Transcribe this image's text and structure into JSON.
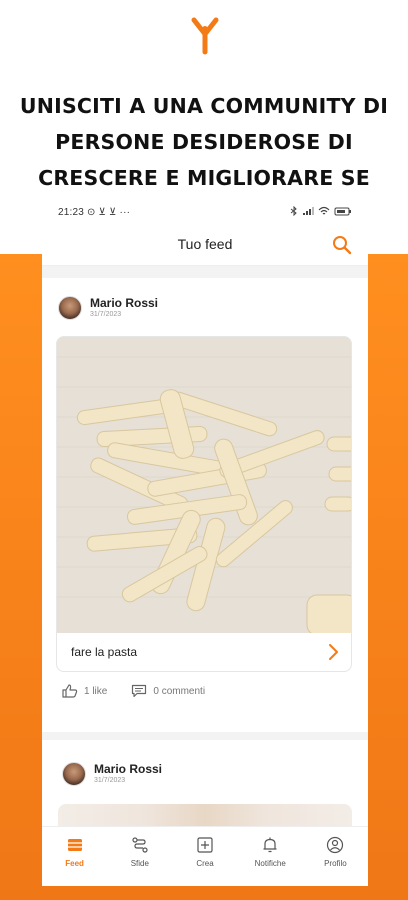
{
  "headline": {
    "line1": "UNISCITI A UNA COMMUNITY DI",
    "line2": "PERSONE DESIDEROSE DI",
    "line3": "CRESCERE E MIGLIORARE SE STESSE"
  },
  "colors": {
    "accent": "#f47a16",
    "background_orange": "#f7811a"
  },
  "status_bar": {
    "time_and_icons": "21:23 ⊙ ⊻ ⊻ ···"
  },
  "app_bar": {
    "title": "Tuo feed",
    "search_icon": "search-icon"
  },
  "feed": [
    {
      "user_name": "Mario Rossi",
      "date": "31/7/2023",
      "caption": "fare la pasta",
      "likes": "1 like",
      "comments": "0 commenti"
    },
    {
      "user_name": "Mario Rossi",
      "date": "31/7/2023"
    }
  ],
  "bottom_nav": [
    {
      "label": "Feed",
      "icon": "feed-icon",
      "active": true
    },
    {
      "label": "Sfide",
      "icon": "route-icon",
      "active": false
    },
    {
      "label": "Crea",
      "icon": "plus-square-icon",
      "active": false
    },
    {
      "label": "Notifiche",
      "icon": "bell-icon",
      "active": false
    },
    {
      "label": "Profilo",
      "icon": "user-circle-icon",
      "active": false
    }
  ]
}
